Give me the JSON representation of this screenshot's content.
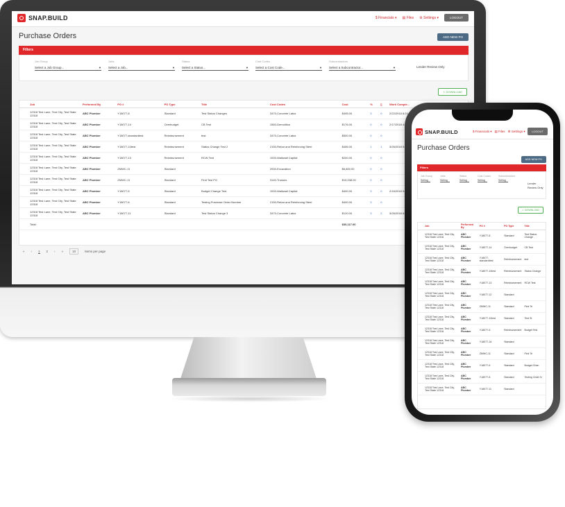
{
  "app": {
    "logo": "SNAP.BUILD"
  },
  "nav": {
    "financials": "$ Financials ▾",
    "files": "▤ Files",
    "settings": "⚙ Settings ▾",
    "logout": "LOGOUT"
  },
  "page": {
    "title": "Purchase Orders",
    "add_po": "ADD NEW PO",
    "filters": "Filters",
    "download": "DOWNLOAD"
  },
  "filters": [
    {
      "label": "Job Group",
      "value": "Select a Job Group..."
    },
    {
      "label": "Jobs",
      "value": "Select a Job..."
    },
    {
      "label": "Status",
      "value": "Select a Status..."
    },
    {
      "label": "Cost Codes",
      "value": "Select a Cost Code..."
    },
    {
      "label": "Subcontractors",
      "value": "Select a Subcontractor..."
    }
  ],
  "lender": "Lender Review Only",
  "table": {
    "headers": [
      "Job",
      "Performed By",
      "PO #",
      "PO Type",
      "Title",
      "Cost Codes",
      "Cost",
      "",
      "",
      "Work Comple...",
      "Approved Date"
    ],
    "rows": [
      [
        "12318 Test Lane, Test City, Test State 12318",
        "ABC Plumber",
        "Y18077-8",
        "Standard",
        "Test Status Changes",
        "3470-Concrete Labor",
        "$495.00",
        "3",
        "0",
        "2/22/2018 8:24 PM",
        "2/22/2018 PM"
      ],
      [
        "12318 Test Lane, Test City, Test State 12318",
        "ABC Plumber",
        "Y18077-14",
        "Overbudget",
        "CB Test",
        "1560-Demolition",
        "$176.00",
        "0",
        "0",
        "2/17/2018 4:23 AM",
        "6/17/2018 AM"
      ],
      [
        "12318 Test Lane, Test City, Test State 12318",
        "ABC Plumber",
        "Y18077-standardtest",
        "Reimbursement",
        "test",
        "3470-Concrete Labor",
        "$500.00",
        "0",
        "0",
        "",
        "3/21/2018 PM"
      ],
      [
        "12318 Test Lane, Test City, Test State 12318",
        "ABC Plumber",
        "Y18077-10test",
        "Reimbursement",
        "Status Change Test 2",
        "2150-Rebar and Reinforcing Steel",
        "$456.00",
        "1",
        "1",
        "3/26/2018 5:42 AM",
        "3/21/2018 PM"
      ],
      [
        "12318 Test Lane, Test City, Test State 12318",
        "ABC Plumber",
        "Y18077-13",
        "Reimbursement",
        "RCW Test",
        "1000-Walkwall Capital",
        "$200.00",
        "0",
        "0",
        "",
        ""
      ],
      [
        "12318 Test Lane, Test City, Test State 12318",
        "ABC Plumber",
        "ZMWC-11",
        "Standard",
        "",
        "2000-Excavation",
        "$6,800.00",
        "0",
        "0",
        "",
        ""
      ],
      [
        "12318 Test Lane, Test City, Test State 12318",
        "ABC Plumber",
        "ZMWC-11",
        "Standard",
        "First Test PO",
        "3140-Trusses",
        "$15,038.00",
        "0",
        "0",
        "",
        ""
      ],
      [
        "12318 Test Lane, Test City, Test State 12318",
        "ABC Plumber",
        "Y18077-5",
        "Standard",
        "Budget Change Test",
        "1000-Walkwall Capital",
        "$400.00",
        "3",
        "0",
        "2/16/2018 5:15 PM",
        "4/6/2018 PM"
      ],
      [
        "12318 Test Lane, Test City, Test State 12318",
        "ABC Plumber",
        "Y18077-6",
        "Standard",
        "Testing Purchase Order Number",
        "2150-Rebar and Reinforcing Steel",
        "$400.00",
        "3",
        "0",
        "",
        "2/16/2018 PM"
      ],
      [
        "12318 Test Lane, Test City, Test State 12318",
        "ABC Plumber",
        "Y18077-11",
        "Standard",
        "Test Status Change 3",
        "3470-Concrete Labor",
        "$120.00",
        "3",
        "2",
        "3/26/2018 6:41 AM",
        "3/26/2018 AM"
      ]
    ],
    "total_label": "Total:",
    "total_value": "$30,117.00"
  },
  "pager": {
    "first": "«",
    "prev": "‹",
    "page1": "1",
    "page2": "2",
    "next": "›",
    "last": "»",
    "per_page": "10",
    "per_page_label": "Items per page"
  },
  "phone": {
    "filters": [
      {
        "label": "Job Group",
        "value": "Selling"
      },
      {
        "label": "Jobs",
        "value": "Selling"
      },
      {
        "label": "Status",
        "value": "Selling"
      },
      {
        "label": "Cost Codes",
        "value": "Selling"
      },
      {
        "label": "Subcontractors",
        "value": "Selling"
      }
    ],
    "lender": "Lender Review Only",
    "headers": [
      "Job",
      "Performed By",
      "PO #",
      "PO Type",
      "Title"
    ],
    "rows": [
      [
        "12318 Test Lane, Test City, Test State 12318",
        "ABC Plumber",
        "Y18077-8",
        "Standard",
        "Test Status Change"
      ],
      [
        "12318 Test Lane, Test City, Test State 12318",
        "ABC Plumber",
        "Y18077-14",
        "Overbudget",
        "CB Test"
      ],
      [
        "12318 Test Lane, Test City, Test State 12318",
        "ABC Plumber",
        "Y18077-standardtest",
        "Reimbursement",
        "test"
      ],
      [
        "12318 Test Lane, Test City, Test State 12318",
        "ABC Plumber",
        "Y18077-10test",
        "Reimbursement",
        "Status Change"
      ],
      [
        "12318 Test Lane, Test City, Test State 12318",
        "ABC Plumber",
        "Y18077-13",
        "Reimbursement",
        "RCW Test"
      ],
      [
        "12318 Test Lane, Test City, Test State 12318",
        "ABC Plumber",
        "Y18077-12",
        "Standard",
        ""
      ],
      [
        "12318 Test Lane, Test City, Test State 12318",
        "ABC Plumber",
        "ZMWC-11",
        "Standard",
        "First Te"
      ],
      [
        "12318 Test Lane, Test City, Test State 12318",
        "ABC Plumber",
        "Y18077-10test",
        "Standard",
        "Test St"
      ],
      [
        "12318 Test Lane, Test City, Test State 12318",
        "ABC Plumber",
        "Y18077-5",
        "Reimbursement",
        "Budget Test"
      ],
      [
        "12318 Test Lane, Test City, Test State 12318",
        "ABC Plumber",
        "Y18077-16",
        "Standard",
        ""
      ],
      [
        "12318 Test Lane, Test City, Test State 12318",
        "ABC Plumber",
        "ZMWC-11",
        "Standard",
        "First Te"
      ],
      [
        "12318 Test Lane, Test City, Test State 12318",
        "ABC Plumber",
        "Y18077-6",
        "Standard",
        "Budget Chan"
      ],
      [
        "12318 Test Lane, Test City, Test State 12318",
        "ABC Plumber",
        "Y18077-8",
        "Standard",
        "Testing Order N"
      ],
      [
        "12318 Test Lane, Test City, Test State 12318",
        "ABC Plumber",
        "Y18077-11",
        "Standard",
        ""
      ]
    ]
  },
  "colors": {
    "accent_red": "#e0282b",
    "button_blue": "#4d6a85",
    "download_green": "#4caf50"
  }
}
